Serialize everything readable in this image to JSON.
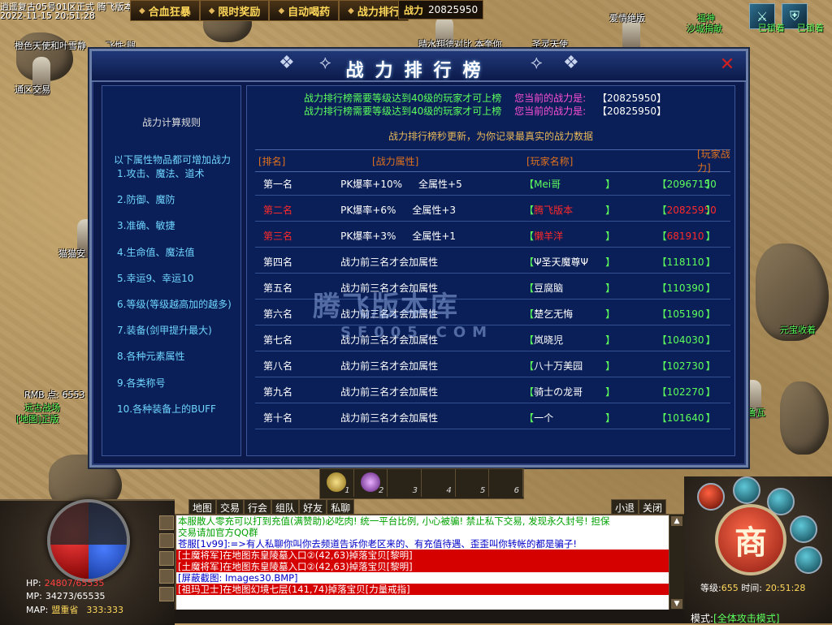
{
  "window": {
    "title": "逍遥复古05号01区正式 腾飞版本",
    "datetime": "2022-11-15 20:51:28"
  },
  "top_menu": [
    {
      "label": "合血狂暴"
    },
    {
      "label": "限时奖励"
    },
    {
      "label": "自动喝药"
    },
    {
      "label": "战力排行"
    }
  ],
  "power_top": {
    "label": "战力",
    "value": "20825950"
  },
  "world_labels": {
    "left_npc1": "橙色天使和叶雪静",
    "left_npc2": "飞性:腿",
    "trade_npc": "通区交易",
    "top_npc1": "晴水翔德对比 本奎你",
    "top_npc2": "圣灵天使",
    "top_npc3": "爱情绝版",
    "top_right_npc": "福神",
    "top_right_npc2": "沙城捐献",
    "skill_caption1": "已锁着",
    "skill_caption2": "已锁着",
    "right_npc1": "元宝收着",
    "right_npc2": "鲁瓦",
    "left_npc3": "猫猫安",
    "rmb_label": "RMB",
    "rmb_value": "点: 6553",
    "left_guild": "远古战场",
    "left_guild2": "[地图]正版"
  },
  "dialog": {
    "title": "战力排行榜",
    "close_icon": "close-icon",
    "rules_title": "战力计算规则",
    "rules_intro": "以下属性物品都可增加战力",
    "rules": [
      "1.攻击、魔法、道术",
      "2.防御、魔防",
      "3.准确、敏捷",
      "4.生命值、魔法值",
      "5.幸运9、幸运10",
      "6.等级(等级越高加的越多)",
      "7.装备(剑甲提升最大)",
      "8.各种元素属性",
      "9.各类称号",
      "10.各种装备上的BUFF"
    ],
    "notice_text": "战力排行榜需要等级达到40级的玩家才可上榜",
    "notice_label": "您当前的战力是:",
    "notice_value": "【20825950】",
    "sub_notice": "战力排行榜秒更新，为你记录最真实的战力数据",
    "headers": {
      "rank": "[排名]",
      "attr": "[战力属性]",
      "name": "[玩家名称]",
      "power": "[玩家战力]"
    },
    "rows": [
      {
        "rank": "第一名",
        "attr1": "PK爆率+10%",
        "attr2": "全属性+5",
        "name": "Mei哥",
        "power": "20967150",
        "rank_color": "#ffffff",
        "name_color": "#5dff5d",
        "power_color": "#5dff5d",
        "attr_color": "#ffffff"
      },
      {
        "rank": "第二名",
        "attr1": "PK爆率+6%",
        "attr2": "全属性+3",
        "name": "腾飞版本",
        "power": "20825950",
        "rank_color": "#ff2a2a",
        "name_color": "#ff2a2a",
        "power_color": "#ff2a2a",
        "attr_color": "#ffffff"
      },
      {
        "rank": "第三名",
        "attr1": "PK爆率+3%",
        "attr2": "全属性+1",
        "name": "懒羊洋",
        "power": "681910",
        "rank_color": "#ff2a2a",
        "name_color": "#ff2a2a",
        "power_color": "#ff2a2a",
        "attr_color": "#ffffff"
      },
      {
        "rank": "第四名",
        "attr1": "战力前三名才会加属性",
        "attr2": "",
        "name": "Ψ圣天魔尊Ψ",
        "power": "118110",
        "rank_color": "#ffffff",
        "name_color": "#ffffff",
        "power_color": "#5dff5d",
        "attr_color": "#ffffff"
      },
      {
        "rank": "第五名",
        "attr1": "战力前三名才会加属性",
        "attr2": "",
        "name": "豆腐脑",
        "power": "110390",
        "rank_color": "#ffffff",
        "name_color": "#ffffff",
        "power_color": "#5dff5d",
        "attr_color": "#ffffff"
      },
      {
        "rank": "第六名",
        "attr1": "战力前三名才会加属性",
        "attr2": "",
        "name": "楚乞无悔",
        "power": "105190",
        "rank_color": "#ffffff",
        "name_color": "#ffffff",
        "power_color": "#5dff5d",
        "attr_color": "#ffffff"
      },
      {
        "rank": "第七名",
        "attr1": "战力前三名才会加属性",
        "attr2": "",
        "name": "岚晓児",
        "power": "104030",
        "rank_color": "#ffffff",
        "name_color": "#ffffff",
        "power_color": "#5dff5d",
        "attr_color": "#ffffff"
      },
      {
        "rank": "第八名",
        "attr1": "战力前三名才会加属性",
        "attr2": "",
        "name": "八十万美园",
        "power": "102730",
        "rank_color": "#ffffff",
        "name_color": "#ffffff",
        "power_color": "#5dff5d",
        "attr_color": "#ffffff"
      },
      {
        "rank": "第九名",
        "attr1": "战力前三名才会加属性",
        "attr2": "",
        "name": "骑士の龙哥",
        "power": "102270",
        "rank_color": "#ffffff",
        "name_color": "#ffffff",
        "power_color": "#5dff5d",
        "attr_color": "#ffffff"
      },
      {
        "rank": "第十名",
        "attr1": "战力前三名才会加属性",
        "attr2": "",
        "name": "一个",
        "power": "101640",
        "rank_color": "#ffffff",
        "name_color": "#ffffff",
        "power_color": "#5dff5d",
        "attr_color": "#ffffff"
      }
    ]
  },
  "watermark": {
    "text": "腾飞版本库",
    "domain": "SF005.COM"
  },
  "hud": {
    "hp_label": "HP:",
    "hp_value": "24807/65535",
    "mp_label": "MP:",
    "mp_value": "34273/65535",
    "hp_fraction": 0.379,
    "mp_fraction": 0.523,
    "map_label": "MAP:",
    "map_name": "盟重省",
    "coords": "333:333",
    "belt_slots": [
      "1",
      "2",
      "3",
      "4",
      "5",
      "6"
    ],
    "chat_tabs": [
      "地图",
      "交易",
      "行会",
      "组队",
      "好友",
      "私聊"
    ],
    "right_tabs": [
      "小退",
      "关闭"
    ],
    "chat_lines": [
      {
        "style": "c-green",
        "text": "本服散人零充可以打到充值(满赞助)必吃肉! 统一平台比例, 小心被骗! 禁止私下交易, 发现永久封号! 担保"
      },
      {
        "style": "c-green",
        "text": "交易请加官方QQ群"
      },
      {
        "style": "c-blue",
        "text": "苍服[1v99]:=>有人私聊你叫你去频道告诉你老区来的、有充值待遇、歪歪叫你转帐的都是骗子!"
      },
      {
        "style": "c-redbg",
        "text": "[土魔将军]在地图东皇陵墓入口②(42,63)掉落宝贝[黎明]"
      },
      {
        "style": "c-redbg",
        "text": "[土魔将军]在地图东皇陵墓入口②(42,63)掉落宝贝[黎明]"
      },
      {
        "style": "c-sys",
        "text": "[屏蔽截图: Images30.BMP]"
      },
      {
        "style": "c-redbg",
        "text": "[祖玛卫士]在地图幻境七层(141,74)掉落宝贝[力量戒指]"
      }
    ],
    "shop_label": "商",
    "level_label": "等级:",
    "level_value": "655",
    "time_label": "时间:",
    "time_value": "20:51:28",
    "mode_label": "模式:",
    "mode_value": "[全体攻击模式]"
  }
}
